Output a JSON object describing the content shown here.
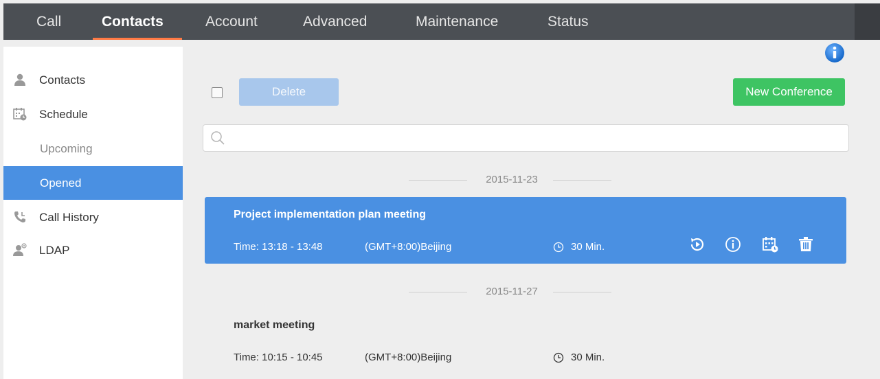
{
  "nav": {
    "tabs": [
      {
        "label": "Call"
      },
      {
        "label": "Contacts"
      },
      {
        "label": "Account"
      },
      {
        "label": "Advanced"
      },
      {
        "label": "Maintenance"
      },
      {
        "label": "Status"
      }
    ],
    "active_tab": "Contacts"
  },
  "sidebar": {
    "items": [
      {
        "label": "Contacts",
        "icon": "person-icon"
      },
      {
        "label": "Schedule",
        "icon": "calendar-clock-icon"
      },
      {
        "label": "Upcoming"
      },
      {
        "label": "Opened"
      },
      {
        "label": "Call History",
        "icon": "phone-history-icon"
      },
      {
        "label": "LDAP",
        "icon": "ldap-user-icon"
      }
    ],
    "active_item": "Opened"
  },
  "toolbar": {
    "delete_label": "Delete",
    "new_conference_label": "New Conference"
  },
  "search": {
    "placeholder": "",
    "value": ""
  },
  "groups": [
    {
      "date": "2015-11-23",
      "meetings": [
        {
          "title": "Project implementation plan meeting",
          "time": "Time: 13:18 - 13:48",
          "timezone": "(GMT+8:00)Beijing",
          "duration": "30 Min.",
          "selected": true
        }
      ]
    },
    {
      "date": "2015-11-27",
      "meetings": [
        {
          "title": "market meeting",
          "time": "Time: 10:15 - 10:45",
          "timezone": "(GMT+8:00)Beijing",
          "duration": "30 Min.",
          "selected": false
        }
      ]
    }
  ],
  "colors": {
    "nav_bg": "#4b4f54",
    "accent_underline": "#ff7a45",
    "selection_blue": "#4a90e2",
    "new_button_green": "#3ec463",
    "delete_button_disabled": "#a8c7ec"
  }
}
